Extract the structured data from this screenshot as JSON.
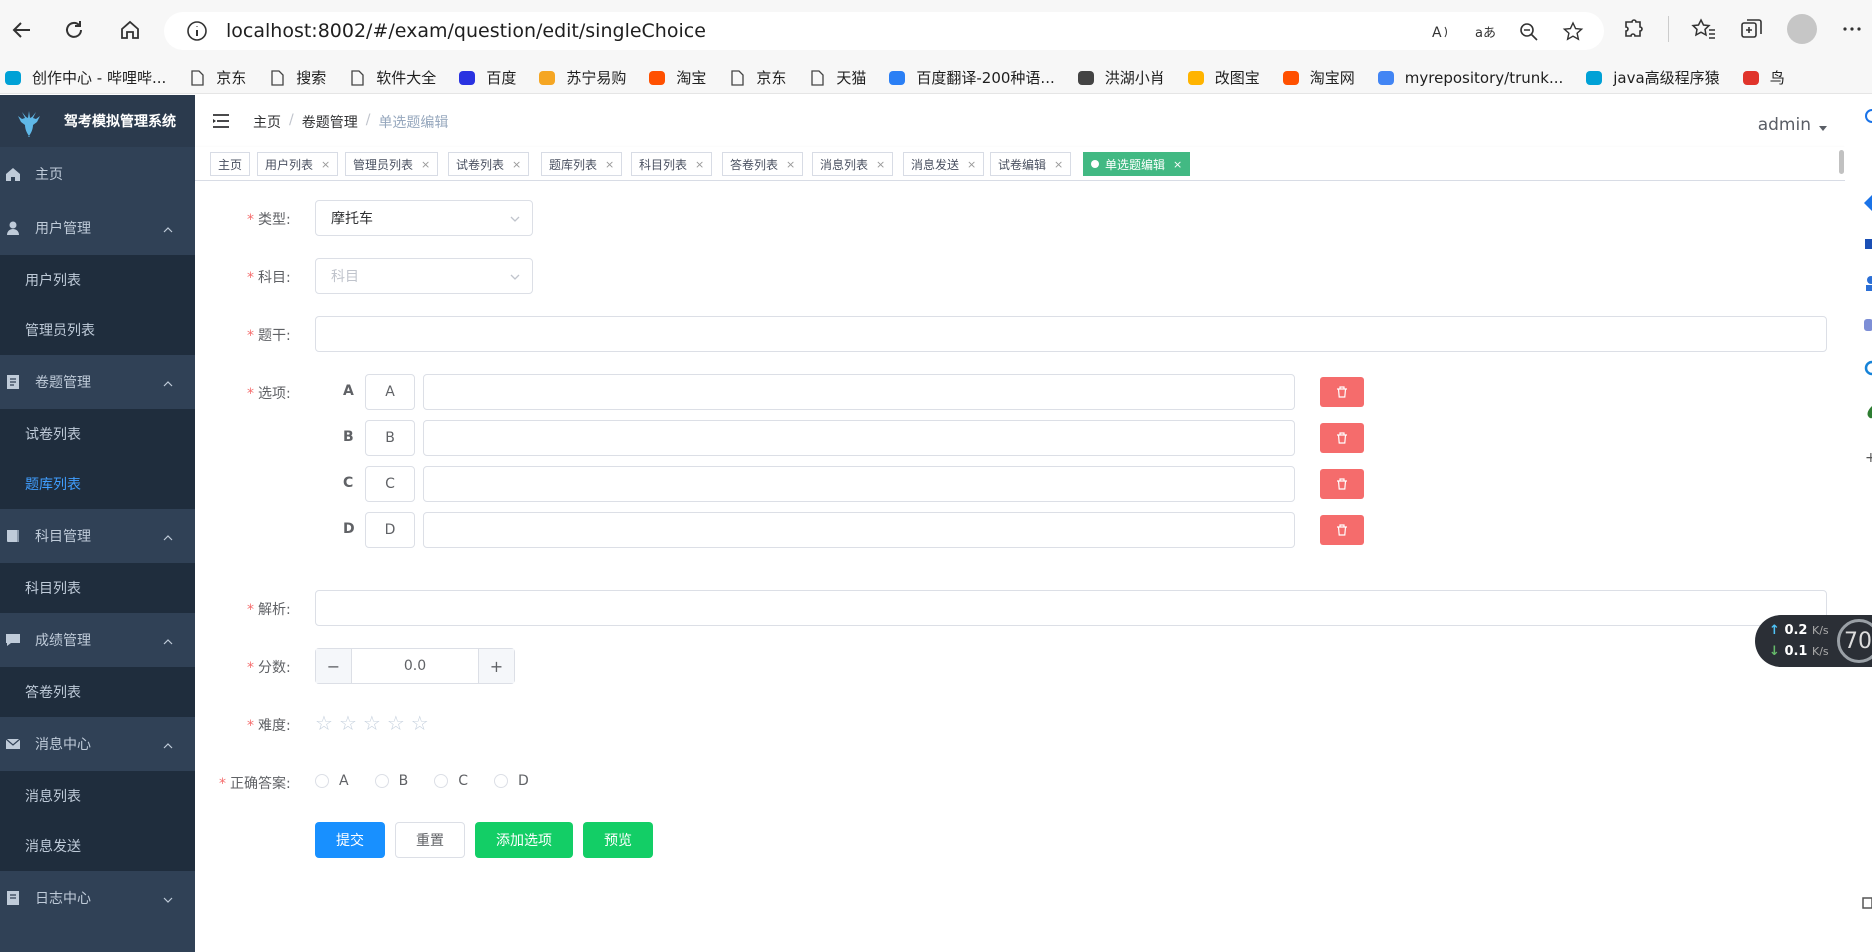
{
  "browser": {
    "url": "localhost:8002/#/exam/question/edit/singleChoice",
    "bookmarks": [
      {
        "label": "创作中心 - 哔哩哔...",
        "icon": "bilibili-icon",
        "color": "#00a1d6"
      },
      {
        "label": "京东",
        "icon": "page-icon",
        "color": "#666666"
      },
      {
        "label": "搜索",
        "icon": "page-icon",
        "color": "#666666"
      },
      {
        "label": "软件大全",
        "icon": "page-icon",
        "color": "#666666"
      },
      {
        "label": "百度",
        "icon": "baidu-icon",
        "color": "#2932e1"
      },
      {
        "label": "苏宁易购",
        "icon": "suning-icon",
        "color": "#f5a623"
      },
      {
        "label": "淘宝",
        "icon": "taobao-icon",
        "color": "#ff5000"
      },
      {
        "label": "京东",
        "icon": "page-icon",
        "color": "#666666"
      },
      {
        "label": "天猫",
        "icon": "page-icon",
        "color": "#666666"
      },
      {
        "label": "百度翻译-200种语...",
        "icon": "translate-icon",
        "color": "#2a7ff5"
      },
      {
        "label": "洪湖小肖",
        "icon": "bird-icon",
        "color": "#444444"
      },
      {
        "label": "改图宝",
        "icon": "gaitubao-icon",
        "color": "#ffb400"
      },
      {
        "label": "淘宝网",
        "icon": "taobao-icon",
        "color": "#ff5000"
      },
      {
        "label": "myrepository/trunk...",
        "icon": "chrome-icon",
        "color": "#4285f4"
      },
      {
        "label": "java高级程序猿",
        "icon": "bilibili-icon",
        "color": "#00a1d6"
      },
      {
        "label": "鸟",
        "icon": "bird-icon",
        "color": "#e0342b"
      }
    ]
  },
  "app": {
    "title": "驾考模拟管理系统",
    "user": "admin",
    "menu": [
      {
        "label": "主页",
        "icon": "home-icon",
        "type": "item"
      },
      {
        "label": "用户管理",
        "icon": "user-icon",
        "type": "group",
        "expanded": true
      },
      {
        "label": "用户列表",
        "type": "sub"
      },
      {
        "label": "管理员列表",
        "type": "sub"
      },
      {
        "label": "卷题管理",
        "icon": "document-icon",
        "type": "group",
        "expanded": true
      },
      {
        "label": "试卷列表",
        "type": "sub"
      },
      {
        "label": "题库列表",
        "type": "sub",
        "active": true
      },
      {
        "label": "科目管理",
        "icon": "book-icon",
        "type": "group",
        "expanded": true
      },
      {
        "label": "科目列表",
        "type": "sub"
      },
      {
        "label": "成绩管理",
        "icon": "message-icon",
        "type": "group",
        "expanded": true
      },
      {
        "label": "答卷列表",
        "type": "sub"
      },
      {
        "label": "消息中心",
        "icon": "mail-icon",
        "type": "group",
        "expanded": true
      },
      {
        "label": "消息列表",
        "type": "sub"
      },
      {
        "label": "消息发送",
        "type": "sub"
      },
      {
        "label": "日志中心",
        "icon": "log-icon",
        "type": "group",
        "expanded": false
      }
    ],
    "breadcrumb": [
      "主页",
      "卷题管理",
      "单选题编辑"
    ],
    "tags": [
      {
        "label": "主页",
        "closable": false
      },
      {
        "label": "用户列表",
        "closable": true
      },
      {
        "label": "管理员列表",
        "closable": true
      },
      {
        "label": "试卷列表",
        "closable": true
      },
      {
        "label": "题库列表",
        "closable": true
      },
      {
        "label": "科目列表",
        "closable": true
      },
      {
        "label": "答卷列表",
        "closable": true
      },
      {
        "label": "消息列表",
        "closable": true
      },
      {
        "label": "消息发送",
        "closable": true
      },
      {
        "label": "试卷编辑",
        "closable": true
      },
      {
        "label": "单选题编辑",
        "closable": true,
        "active": true
      }
    ]
  },
  "form": {
    "type_label": "类型:",
    "type_value": "摩托车",
    "subject_label": "科目:",
    "subject_placeholder": "科目",
    "stem_label": "题干:",
    "options_label": "选项:",
    "options": [
      {
        "letter": "A",
        "prefix": "A",
        "content": ""
      },
      {
        "letter": "B",
        "prefix": "B",
        "content": ""
      },
      {
        "letter": "C",
        "prefix": "C",
        "content": ""
      },
      {
        "letter": "D",
        "prefix": "D",
        "content": ""
      }
    ],
    "analysis_label": "解析:",
    "score_label": "分数:",
    "score_value": "0.0",
    "difficulty_label": "难度:",
    "difficulty_value": 0,
    "difficulty_max": 5,
    "answer_label": "正确答案:",
    "answer_choices": [
      "A",
      "B",
      "C",
      "D"
    ],
    "buttons": {
      "submit": "提交",
      "reset": "重置",
      "add_option": "添加选项",
      "preview": "预览"
    }
  },
  "netspeed": {
    "up": "0.2",
    "down": "0.1",
    "unit": "K/s",
    "gauge": "70"
  },
  "colors": {
    "sidebar_bg": "#304156",
    "sub_bg": "#1f2d3d",
    "active_link": "#409eff",
    "tag_active": "#42b983",
    "danger": "#f56c6c",
    "primary": "#1890ff",
    "success": "#13ce66"
  }
}
